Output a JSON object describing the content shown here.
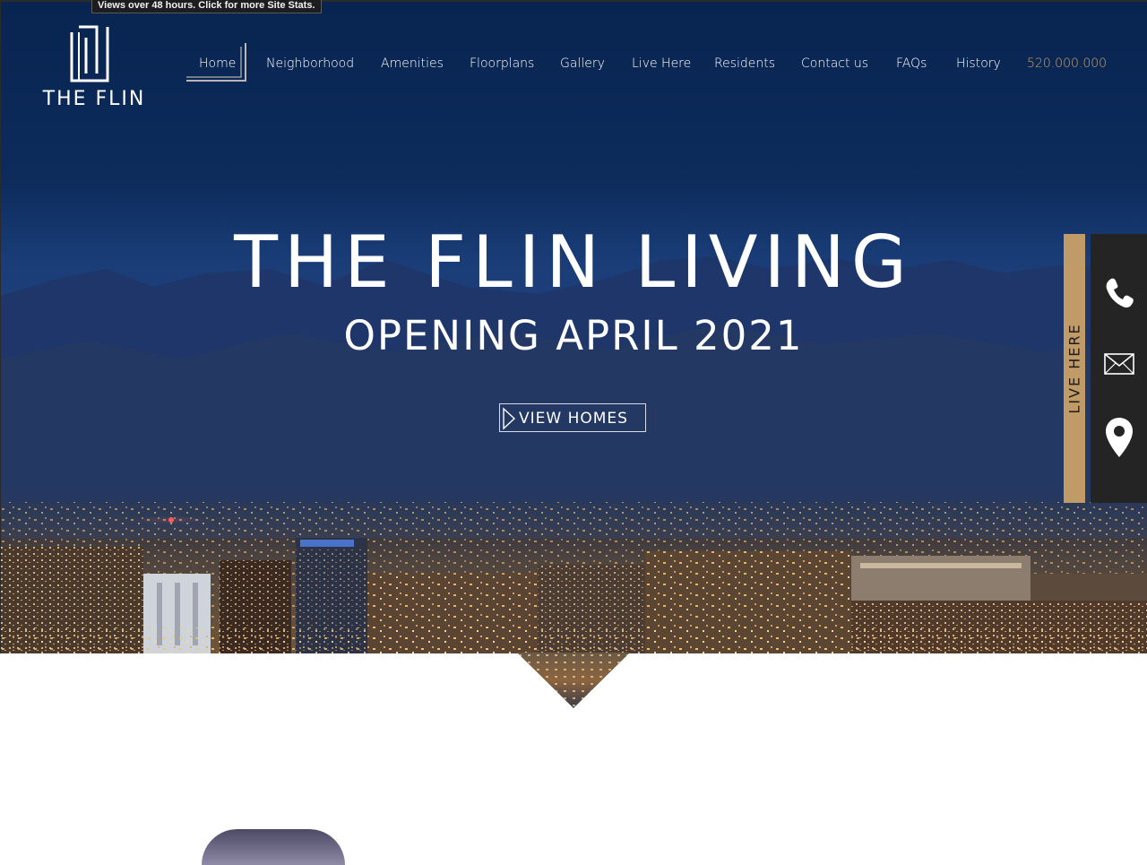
{
  "stats_tab": {
    "text": "Views over 48 hours. Click for more Site Stats."
  },
  "logo": {
    "text": "THE FLIN"
  },
  "nav": {
    "items": [
      {
        "label": "Home"
      },
      {
        "label": "Neighborhood"
      },
      {
        "label": "Amenities"
      },
      {
        "label": "Floorplans"
      },
      {
        "label": "Gallery"
      },
      {
        "label": "Live Here"
      },
      {
        "label": "Residents"
      },
      {
        "label": "Contact us"
      },
      {
        "label": "FAQs"
      },
      {
        "label": "History"
      }
    ],
    "phone": "520.000.000",
    "active": "Home"
  },
  "hero": {
    "title": "THE FLIN LIVING",
    "subtitle": "OPENING APRIL 2021",
    "cta_label": "VIEW HOMES"
  },
  "side_panel": {
    "tab_label": "LIVE HERE",
    "icons": [
      "phone-icon",
      "envelope-icon",
      "map-pin-icon"
    ]
  },
  "colors": {
    "accent_gold": "#c09a67",
    "phone_link": "#c7a36b",
    "hero_sky": "#0d2c5c",
    "side_dark": "#242424"
  }
}
